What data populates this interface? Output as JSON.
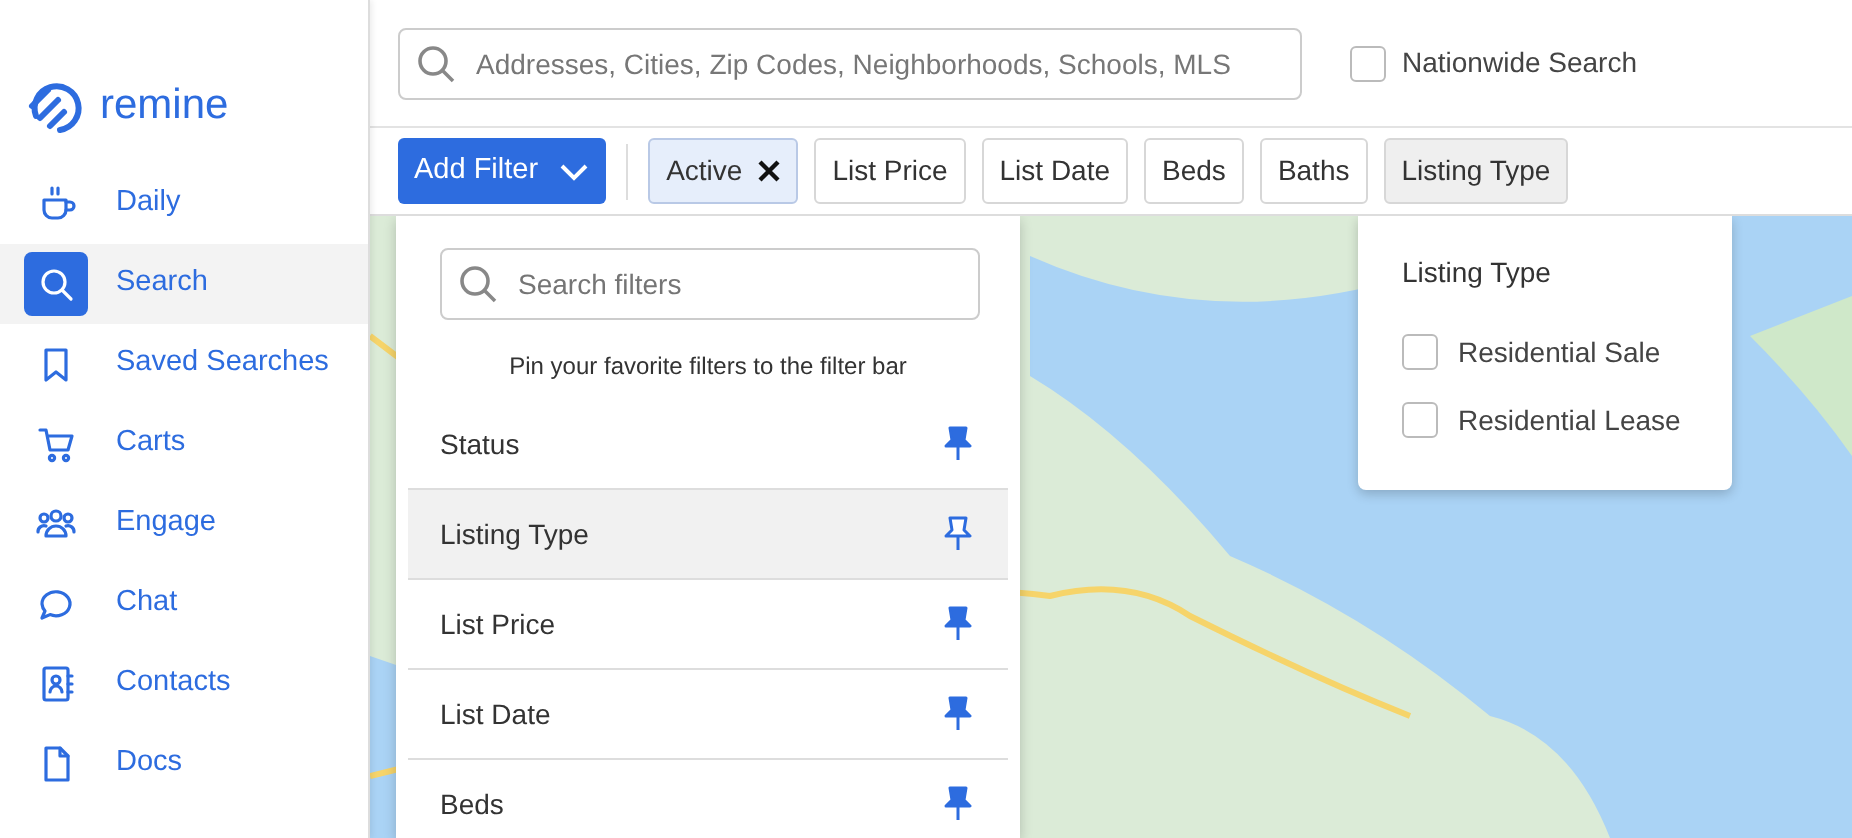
{
  "logo": {
    "text": "remine"
  },
  "sidebar": {
    "items": [
      {
        "label": "Daily",
        "kind": "cup",
        "selected": false
      },
      {
        "label": "Search",
        "kind": "search",
        "selected": true
      },
      {
        "label": "Saved Searches",
        "kind": "bookmark",
        "selected": false
      },
      {
        "label": "Carts",
        "kind": "cart",
        "selected": false
      },
      {
        "label": "Engage",
        "kind": "people",
        "selected": false
      },
      {
        "label": "Chat",
        "kind": "chat",
        "selected": false
      },
      {
        "label": "Contacts",
        "kind": "contacts",
        "selected": false
      },
      {
        "label": "Docs",
        "kind": "doc",
        "selected": false
      }
    ]
  },
  "search": {
    "placeholder": "Addresses, Cities, Zip Codes, Neighborhoods, Schools, MLS"
  },
  "nationwide": {
    "label": "Nationwide Search",
    "checked": false
  },
  "filter_bar": {
    "add_filter": "Add Filter",
    "chips": [
      {
        "label": "Active",
        "applied": true,
        "open": false
      },
      {
        "label": "List Price",
        "applied": false,
        "open": false
      },
      {
        "label": "List Date",
        "applied": false,
        "open": false
      },
      {
        "label": "Beds",
        "applied": false,
        "open": false
      },
      {
        "label": "Baths",
        "applied": false,
        "open": false
      },
      {
        "label": "Listing Type",
        "applied": false,
        "open": true
      }
    ]
  },
  "filter_menu": {
    "placeholder": "Search filters",
    "hint": "Pin your favorite filters to the filter bar",
    "items": [
      {
        "label": "Status",
        "pinned": true,
        "selected": false
      },
      {
        "label": "Listing Type",
        "pinned": false,
        "selected": true
      },
      {
        "label": "List Price",
        "pinned": true,
        "selected": false
      },
      {
        "label": "List Date",
        "pinned": true,
        "selected": false
      },
      {
        "label": "Beds",
        "pinned": true,
        "selected": false
      }
    ]
  },
  "listing_type_popover": {
    "title": "Listing Type",
    "options": [
      {
        "label": "Residential Sale",
        "checked": false
      },
      {
        "label": "Residential Lease",
        "checked": false
      }
    ]
  }
}
